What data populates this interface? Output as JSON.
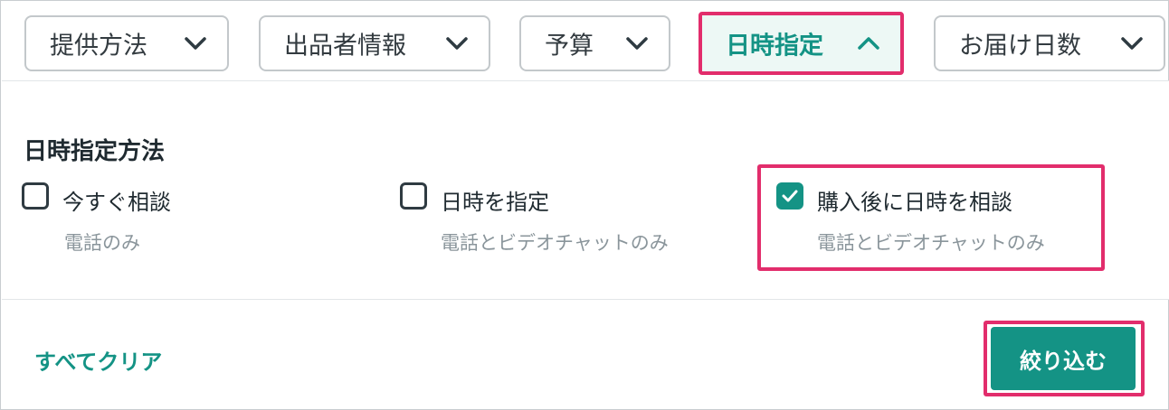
{
  "filters": [
    {
      "label": "提供方法",
      "icon": "chevron-down-icon"
    },
    {
      "label": "出品者情報",
      "icon": "chevron-down-icon"
    },
    {
      "label": "予算",
      "icon": "chevron-down-icon"
    },
    {
      "label": "日時指定",
      "icon": "chevron-up-icon",
      "active": true
    },
    {
      "label": "お届け日数",
      "icon": "chevron-down-icon"
    }
  ],
  "panel": {
    "title": "日時指定方法",
    "options": [
      {
        "label": "今すぐ相談",
        "sub": "電話のみ",
        "checked": false
      },
      {
        "label": "日時を指定",
        "sub": "電話とビデオチャットのみ",
        "checked": false
      },
      {
        "label": "購入後に日時を相談",
        "sub": "電話とビデオチャットのみ",
        "checked": true
      }
    ]
  },
  "footer": {
    "clear_label": "すべてクリア",
    "apply_label": "絞り込む"
  },
  "colors": {
    "accent": "#149385",
    "highlight": "#e22d6c",
    "active_bg": "#edf8f5"
  }
}
